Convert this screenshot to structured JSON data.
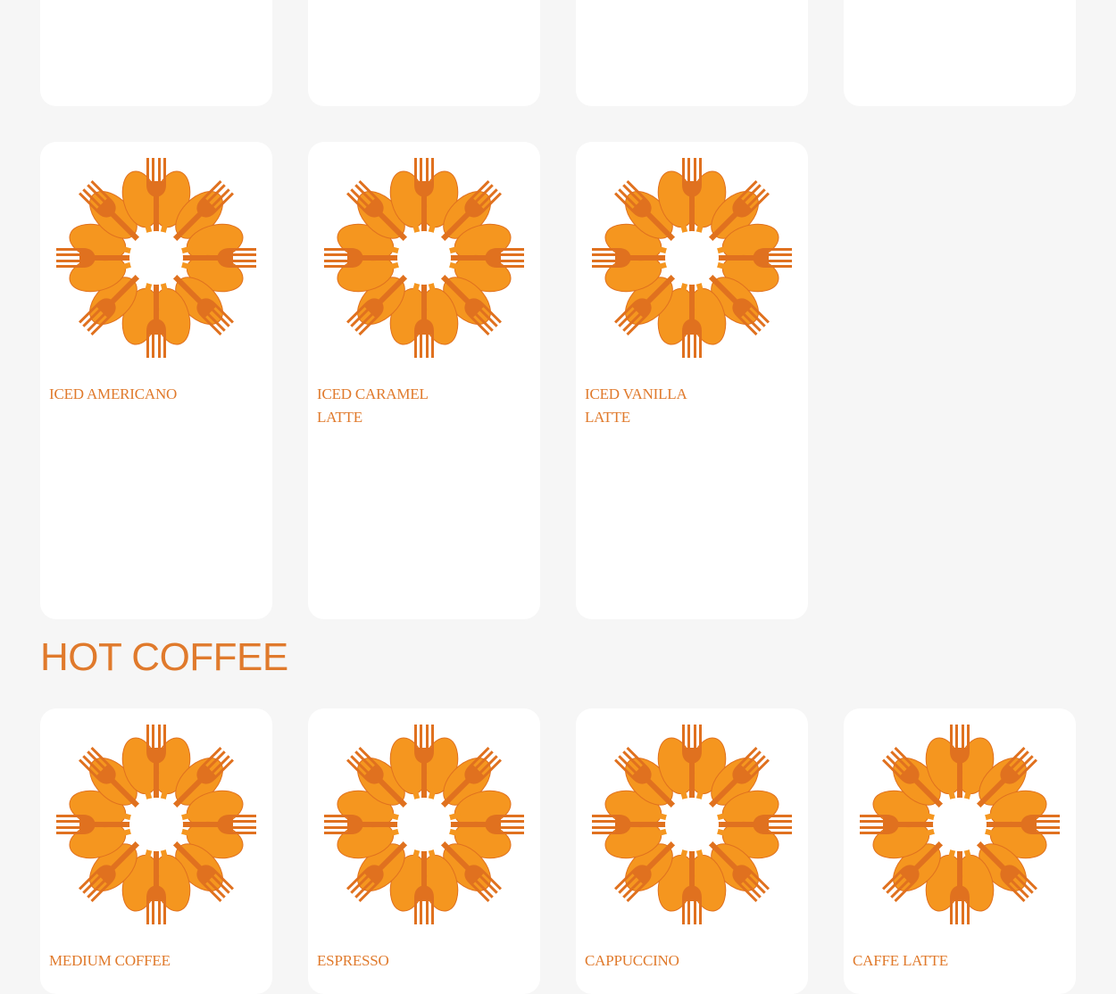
{
  "colors": {
    "background": "#f6f6f6",
    "card": "#ffffff",
    "accent_text": "#e07a2c",
    "logo_light": "#f5961f",
    "logo_dark": "#e0711f"
  },
  "top_row_cards": [
    {
      "id": "top-1"
    },
    {
      "id": "top-2"
    },
    {
      "id": "top-3"
    },
    {
      "id": "top-4"
    }
  ],
  "iced_items": [
    {
      "name": "ICED AMERICANO",
      "icon": "fork-spoon-flower-logo"
    },
    {
      "name": "ICED CARAMEL LATTE",
      "icon": "fork-spoon-flower-logo"
    },
    {
      "name": "ICED VANILLA LATTE",
      "icon": "fork-spoon-flower-logo"
    }
  ],
  "hot_section": {
    "heading": "HOT COFFEE",
    "items": [
      {
        "name": "MEDIUM COFFEE",
        "icon": "fork-spoon-flower-logo"
      },
      {
        "name": "ESPRESSO",
        "icon": "fork-spoon-flower-logo"
      },
      {
        "name": "CAPPUCCINO",
        "icon": "fork-spoon-flower-logo"
      },
      {
        "name": "CAFFE LATTE",
        "icon": "fork-spoon-flower-logo"
      }
    ]
  }
}
